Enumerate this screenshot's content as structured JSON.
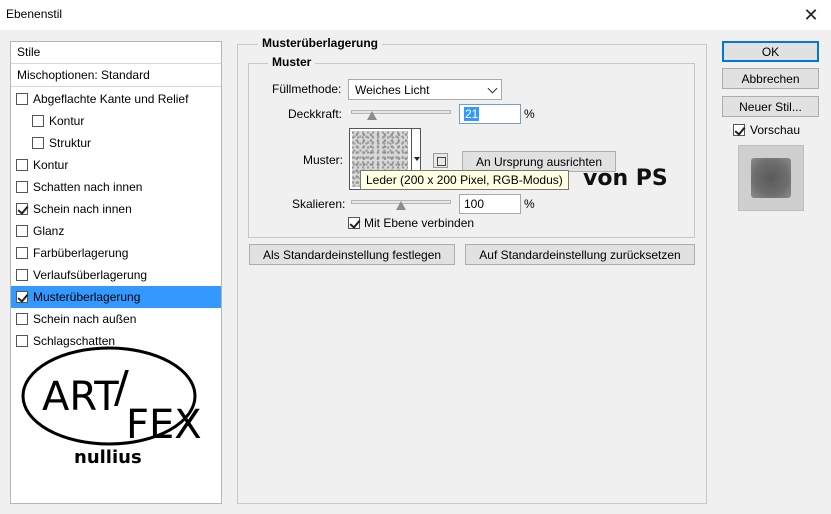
{
  "window": {
    "title": "Ebenenstil",
    "close_glyph": "✕"
  },
  "styles_panel": {
    "header": "Stile",
    "blend_options": "Mischoptionen: Standard",
    "items": [
      {
        "label": "Abgeflachte Kante und Relief",
        "checked": false,
        "indent": false,
        "selected": false
      },
      {
        "label": "Kontur",
        "checked": false,
        "indent": true,
        "selected": false
      },
      {
        "label": "Struktur",
        "checked": false,
        "indent": true,
        "selected": false
      },
      {
        "label": "Kontur",
        "checked": false,
        "indent": false,
        "selected": false
      },
      {
        "label": "Schatten nach innen",
        "checked": false,
        "indent": false,
        "selected": false
      },
      {
        "label": "Schein nach innen",
        "checked": true,
        "indent": false,
        "selected": false
      },
      {
        "label": "Glanz",
        "checked": false,
        "indent": false,
        "selected": false
      },
      {
        "label": "Farbüberlagerung",
        "checked": false,
        "indent": false,
        "selected": false
      },
      {
        "label": "Verlaufsüberlagerung",
        "checked": false,
        "indent": false,
        "selected": false
      },
      {
        "label": "Musterüberlagerung",
        "checked": true,
        "indent": false,
        "selected": true
      },
      {
        "label": "Schein nach außen",
        "checked": false,
        "indent": false,
        "selected": false
      },
      {
        "label": "Schlagschatten",
        "checked": false,
        "indent": false,
        "selected": false
      }
    ]
  },
  "logo": {
    "line1_left": "ART",
    "line1_sep": "/",
    "line1_right": "FEX",
    "line2": "nullius"
  },
  "pattern_overlay": {
    "group_title": "Musterüberlagerung",
    "section_title": "Muster",
    "blend_mode_label": "Füllmethode:",
    "blend_mode_value": "Weiches Licht",
    "opacity_label": "Deckkraft:",
    "opacity_value": "21",
    "opacity_level": 0.21,
    "opacity_unit": "%",
    "pattern_label": "Muster:",
    "snap_to_origin_button": "An Ursprung ausrichten",
    "pattern_tooltip": "Leder (200 x 200 Pixel, RGB-Modus)",
    "scale_label": "Skalieren:",
    "scale_value": "100",
    "scale_level": 0.5,
    "scale_unit": "%",
    "link_with_layer_label": "Mit Ebene verbinden",
    "link_with_layer_checked": true,
    "make_default_button": "Als Standardeinstellung festlegen",
    "reset_default_button": "Auf Standardeinstellung zurücksetzen"
  },
  "annotation": "von PS",
  "right_panel": {
    "ok_button": "OK",
    "cancel_button": "Abbrechen",
    "new_style_button": "Neuer Stil...",
    "preview_label": "Vorschau",
    "preview_checked": true
  },
  "colors": {
    "selection": "#3399ff",
    "tooltip_bg": "#ffffe1",
    "dialog_bg": "#f0f0f0",
    "default_button_border": "#0078d7"
  }
}
